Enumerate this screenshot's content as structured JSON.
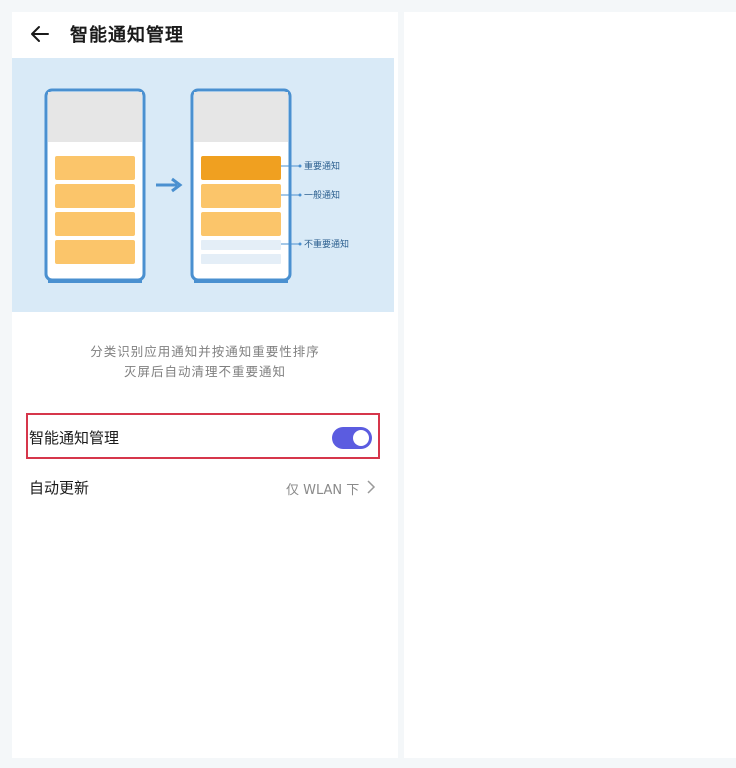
{
  "header": {
    "title": "智能通知管理",
    "back_icon": "arrow-left-icon"
  },
  "illustration": {
    "labels": {
      "important": "重要通知",
      "general": "一般通知",
      "unimportant": "不重要通知"
    },
    "colors": {
      "background": "#d9eaf7",
      "important": "#f0a020",
      "general": "#fbc56a",
      "unimportant": "#e4eef7"
    }
  },
  "description": {
    "line1": "分类识别应用通知并按通知重要性排序",
    "line2": "灭屏后自动清理不重要通知"
  },
  "settings": {
    "smart_notification": {
      "label": "智能通知管理",
      "enabled": true
    },
    "auto_update": {
      "label": "自动更新",
      "value": "仅 WLAN 下",
      "icon": "chevron-right-icon"
    }
  },
  "colors": {
    "accent": "#5b5ce0",
    "highlight_border": "#d6364b"
  }
}
